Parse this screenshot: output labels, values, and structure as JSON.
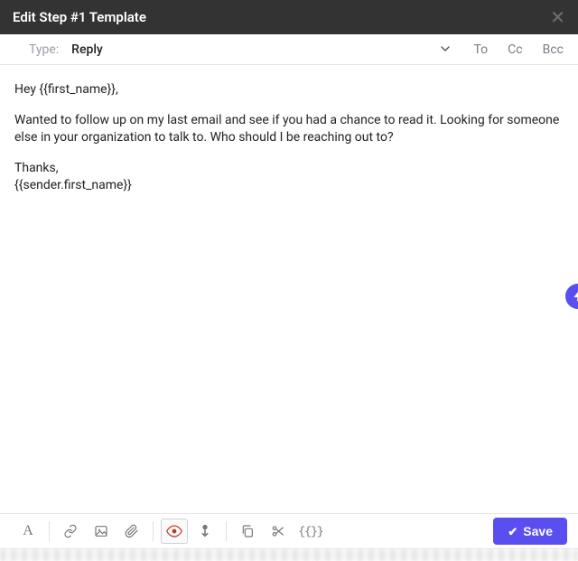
{
  "header": {
    "title": "Edit Step #1 Template"
  },
  "type_row": {
    "label": "Type:",
    "value": "Reply",
    "to": "To",
    "cc": "Cc",
    "bcc": "Bcc"
  },
  "body": {
    "greeting": "Hey {{first_name}},",
    "paragraph": "Wanted to follow up on my last email and see if you had a chance to read it. Looking for someone else in your organization to talk to. Who should I be reaching out to?",
    "thanks": "Thanks,",
    "signature": "{{sender.first_name}}"
  },
  "toolbar": {
    "save_label": "Save",
    "snippets_glyph": "{{}}",
    "font_glyph": "A"
  }
}
